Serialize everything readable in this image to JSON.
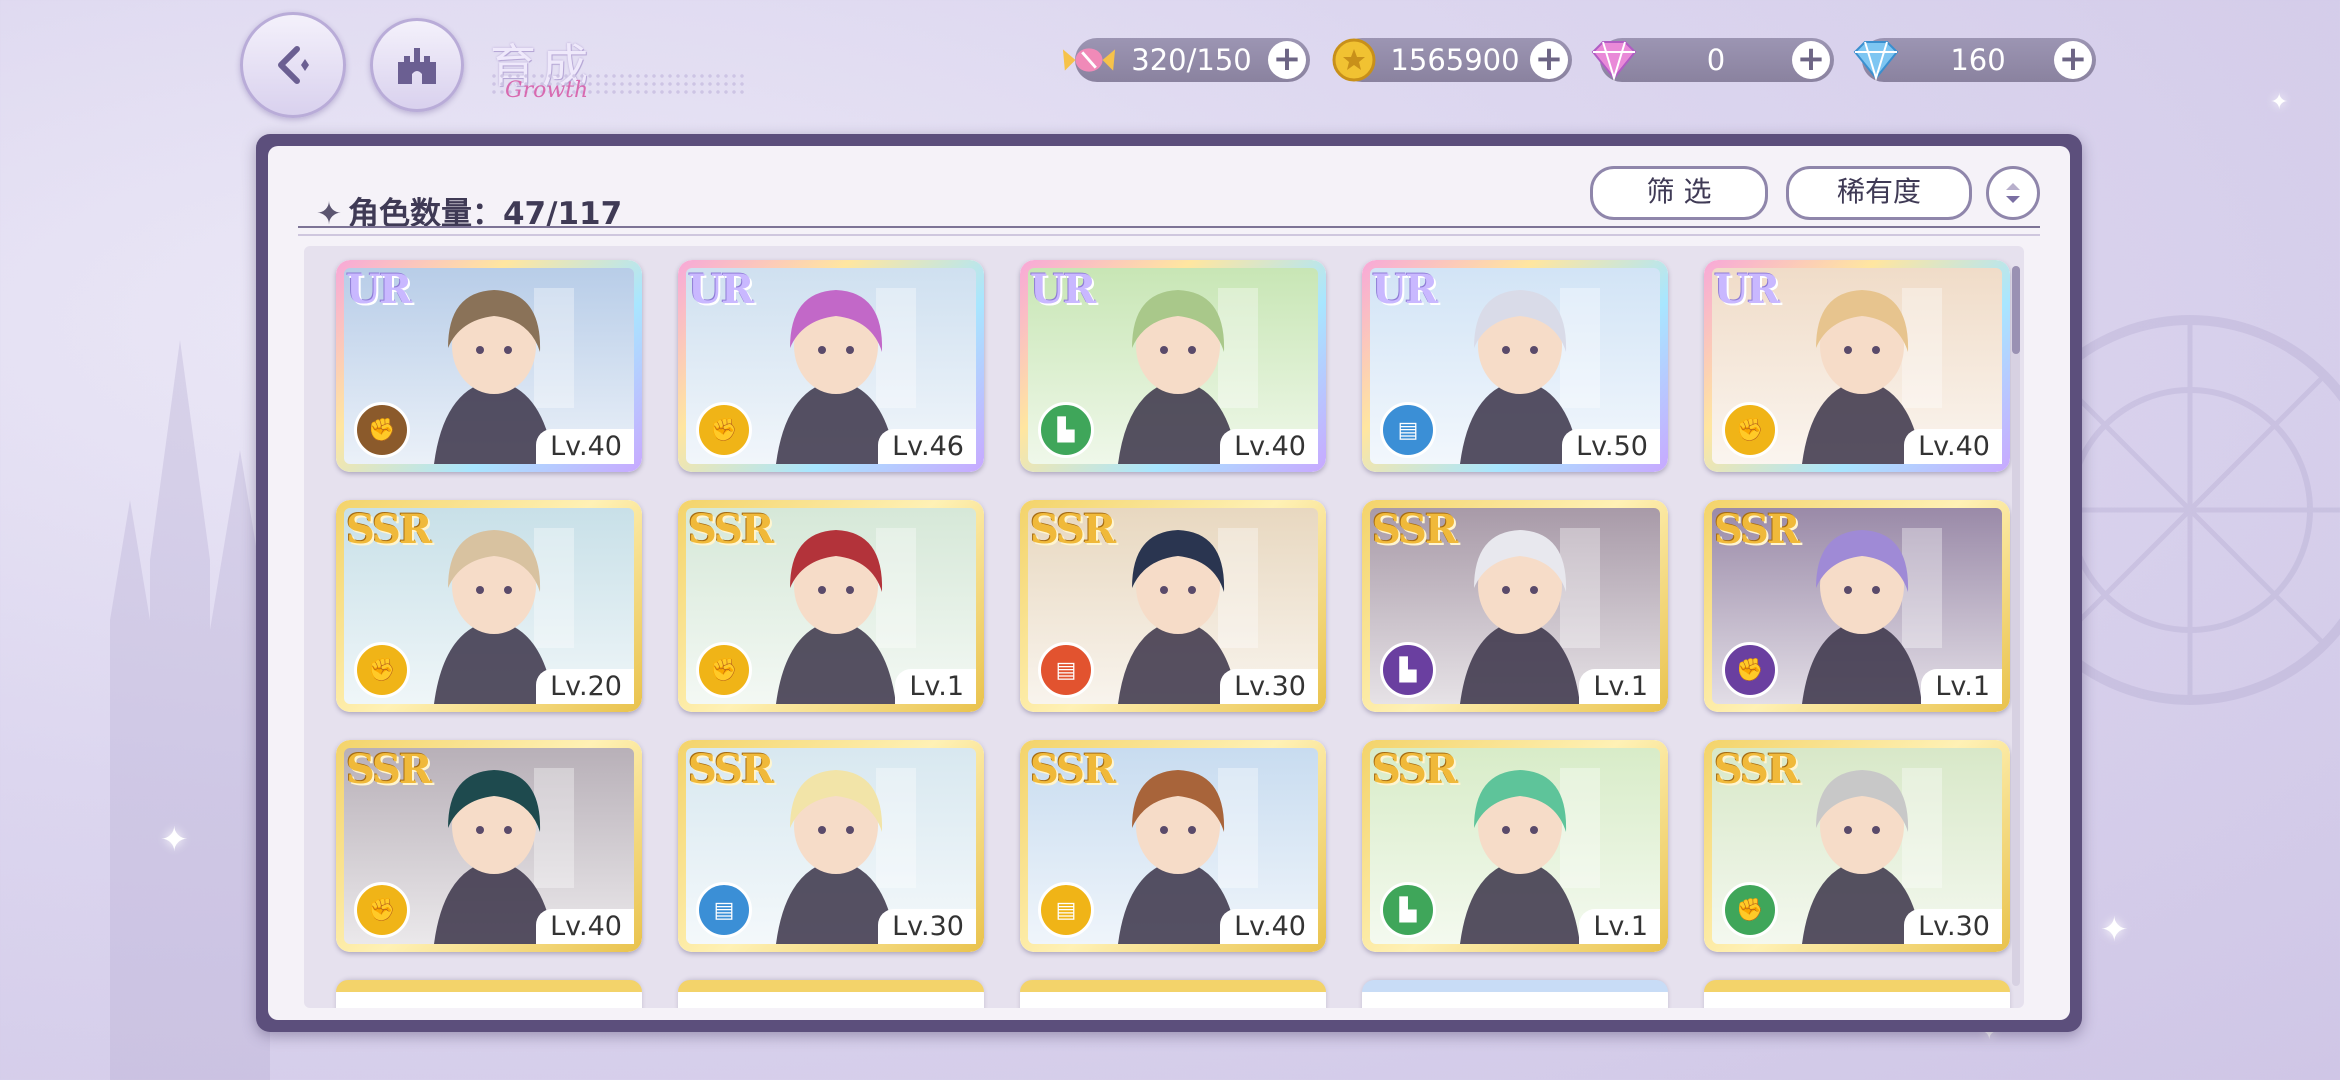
{
  "header": {
    "title": "育成",
    "title_deco": "Growth"
  },
  "resources": [
    {
      "name": "stamina",
      "icon": "candy-icon",
      "value": "320/150"
    },
    {
      "name": "gold",
      "icon": "coin-icon",
      "value": "1565900"
    },
    {
      "name": "paid-gem",
      "icon": "pink-diamond-icon",
      "value": "0"
    },
    {
      "name": "free-gem",
      "icon": "blue-diamond-icon",
      "value": "160"
    }
  ],
  "panel": {
    "count_label": "角色数量：47/117",
    "filter_label": "筛 选",
    "sort_label": "稀有度"
  },
  "colors": {
    "brown": "#8b5a2b",
    "yellow": "#f0b417",
    "green": "#3fa65a",
    "blue": "#3b8fd6",
    "red": "#e2532f",
    "purple": "#6a3fa0"
  },
  "cards": [
    {
      "rarity": "UR",
      "level": "Lv.40",
      "attr_icon": "fist-icon",
      "attr_color": "#8b5a2b",
      "bg": "#b8cde8",
      "hair": "#8a7258"
    },
    {
      "rarity": "UR",
      "level": "Lv.46",
      "attr_icon": "fist-icon",
      "attr_color": "#f0b417",
      "bg": "#cfe0f0",
      "hair": "#c268c8"
    },
    {
      "rarity": "UR",
      "level": "Lv.40",
      "attr_icon": "boot-icon",
      "attr_color": "#3fa65a",
      "bg": "#c8e6b5",
      "hair": "#a9c88a"
    },
    {
      "rarity": "UR",
      "level": "Lv.50",
      "attr_icon": "book-icon",
      "attr_color": "#3b8fd6",
      "bg": "#d2e4f6",
      "hair": "#d9dbe8"
    },
    {
      "rarity": "UR",
      "level": "Lv.40",
      "attr_icon": "fist-icon",
      "attr_color": "#f0b417",
      "bg": "#f0dcc8",
      "hair": "#e7c48e"
    },
    {
      "rarity": "SSR",
      "level": "Lv.20",
      "attr_icon": "fist-icon",
      "attr_color": "#f0b417",
      "bg": "#c8e0e8",
      "hair": "#d8c2a0"
    },
    {
      "rarity": "SSR",
      "level": "Lv.1",
      "attr_icon": "fist-icon",
      "attr_color": "#f0b417",
      "bg": "#d6e8d8",
      "hair": "#b3333a"
    },
    {
      "rarity": "SSR",
      "level": "Lv.30",
      "attr_icon": "book-icon",
      "attr_color": "#e2532f",
      "bg": "#e8d8c0",
      "hair": "#2a3550"
    },
    {
      "rarity": "SSR",
      "level": "Lv.1",
      "attr_icon": "boot-icon",
      "attr_color": "#6a3fa0",
      "bg": "#a89aa8",
      "hair": "#e8e8ee"
    },
    {
      "rarity": "SSR",
      "level": "Lv.1",
      "attr_icon": "fist-icon",
      "attr_color": "#6a3fa0",
      "bg": "#9a8aa8",
      "hair": "#9f8ad6"
    },
    {
      "rarity": "SSR",
      "level": "Lv.40",
      "attr_icon": "fist-icon",
      "attr_color": "#f0b417",
      "bg": "#b8b0b8",
      "hair": "#1e4a4e"
    },
    {
      "rarity": "SSR",
      "level": "Lv.30",
      "attr_icon": "book-icon",
      "attr_color": "#3b8fd6",
      "bg": "#d8e8f0",
      "hair": "#f2e4a8"
    },
    {
      "rarity": "SSR",
      "level": "Lv.40",
      "attr_icon": "book-icon",
      "attr_color": "#f0b417",
      "bg": "#c8dcf0",
      "hair": "#a8643a"
    },
    {
      "rarity": "SSR",
      "level": "Lv.1",
      "attr_icon": "boot-icon",
      "attr_color": "#3fa65a",
      "bg": "#d8ecc8",
      "hair": "#5ec49a"
    },
    {
      "rarity": "SSR",
      "level": "Lv.30",
      "attr_icon": "fist-icon",
      "attr_color": "#3fa65a",
      "bg": "#d8e8c8",
      "hair": "#c8c8c8"
    }
  ]
}
